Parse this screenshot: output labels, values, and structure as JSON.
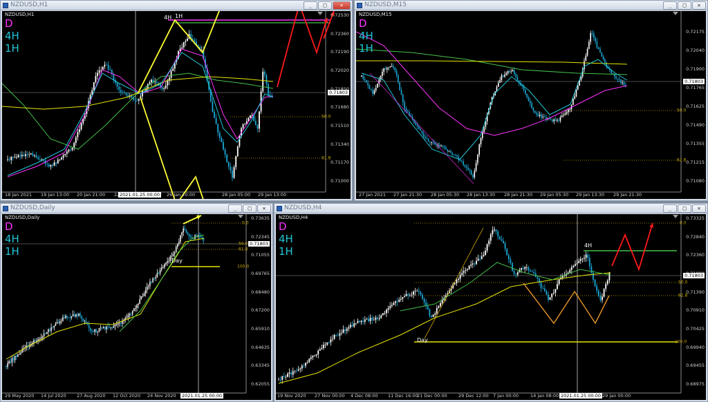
{
  "colors": {
    "bull": "#ffffff",
    "bear": "#1aa7d6",
    "ma_magenta": "#ff33ff",
    "ma_cyan": "#21c7d8",
    "ma_green": "#45c24a",
    "ma_yellow": "#e6e600",
    "arrow_yellow": "#ffff33",
    "arrow_red": "#ff1a1a"
  },
  "window_buttons": {
    "minimize": "_",
    "maximize": "□",
    "close": "✕"
  },
  "windows": [
    {
      "id": "h1",
      "title": "NZDUSD,H1",
      "symbol_label": "NZDUSD,H1",
      "tf_d": "D",
      "tf_4h": "4H",
      "tf_1h": "1H",
      "current_price": "0.71803",
      "price_labels": [
        "0.72530",
        "0.72360",
        "0.72190",
        "0.72020",
        "0.71850",
        "0.71680",
        "0.71510",
        "0.71340",
        "0.71170",
        "0.71000"
      ],
      "fib_labels": [
        "50.0",
        "61.8"
      ],
      "time_labels": [
        "18 Jan 2021",
        "19 Jan 13:00",
        "20 Jan 21:00",
        "22",
        "2021.01.25 00:00",
        "26 Jan 20:00",
        "28 Jan 05:00",
        "29 Jan 13:00"
      ],
      "notes": [
        "4H",
        "1H"
      ]
    },
    {
      "id": "m15",
      "title": "NZDUSD,M15",
      "symbol_label": "NZDUSD,M15",
      "tf_d": "D",
      "tf_4h": "4H",
      "tf_1h": "1H",
      "current_price": "0.71803",
      "price_labels": [
        "0.72175",
        "0.72040",
        "0.71900",
        "0.71765",
        "0.71625",
        "0.71490",
        "0.71355",
        "0.71215",
        "0.71080"
      ],
      "fib_labels": [
        "50.0",
        "61.8"
      ],
      "time_labels": [
        "27 Jan 2021",
        "27 Jan 21:30",
        "28 Jan 05:30",
        "28 Jan 13:30",
        "28 Jan 21:30",
        "29 Jan 05:30",
        "29 Jan 13:30",
        "29 Jan 21:30"
      ]
    },
    {
      "id": "daily",
      "title": "NZDUSD,Daily",
      "symbol_label": "NZDUSD,Daily",
      "tf_d": "D",
      "tf_4h": "4H",
      "tf_1h": "1H",
      "current_price": "0.71803",
      "price_labels": [
        "0.73635",
        "0.72345",
        "0.71055",
        "0.69765",
        "0.68480",
        "0.67200",
        "0.65910",
        "0.64635",
        "0.63345",
        "0.62055"
      ],
      "fib_labels": [
        "0.0",
        "50.0",
        "61.8",
        "100.0"
      ],
      "time_labels": [
        "29 May 2020",
        "14 Jul 2020",
        "27 Aug 2020",
        "12 Oct 2020",
        "24 Nov 2020",
        "2021.01.25 00:00"
      ],
      "notes": [
        "Day"
      ]
    },
    {
      "id": "h4",
      "title": "NZDUSD,H4",
      "symbol_label": "NZDUSD,H4",
      "tf_d": "D",
      "tf_4h": "4H",
      "tf_1h": "1H",
      "current_price": "0.71803",
      "price_labels": [
        "0.73325",
        "0.72840",
        "0.72360",
        "0.71880",
        "0.71390",
        "0.70910",
        "0.70425",
        "0.69940",
        "0.69455",
        "0.68975"
      ],
      "fib_labels": [
        "0.0",
        "50.0",
        "61.8",
        "100.0"
      ],
      "time_labels": [
        "19 Nov 2020",
        "27 Nov 00:00",
        "4 Dec 08:00",
        "11 Dec 16:00",
        "21 Dec 00:00",
        "29 Dec 12:00",
        "7 Jan 00:00",
        "14 Jan 08:00",
        "2021.01.25 00:00",
        "29 Jan 00:00"
      ],
      "notes": [
        "4H",
        "Day"
      ]
    }
  ]
}
